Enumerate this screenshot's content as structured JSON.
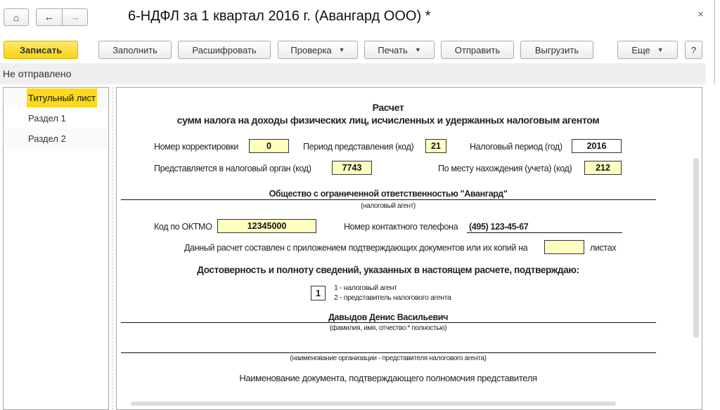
{
  "window": {
    "title": "6-НДФЛ за 1 квартал 2016 г. (Авангард ООО) *",
    "close": "×"
  },
  "toolbar": {
    "save": "Записать",
    "fill": "Заполнить",
    "decode": "Расшифровать",
    "check": "Проверка",
    "print": "Печать",
    "send": "Отправить",
    "export": "Выгрузить",
    "more": "Еще",
    "help": "?"
  },
  "status": "Не отправлено",
  "sidebar": {
    "items": [
      {
        "label": "Титульный лист",
        "active": true
      },
      {
        "label": "Раздел 1"
      },
      {
        "label": "Раздел 2"
      }
    ]
  },
  "form": {
    "title1": "Расчет",
    "title2": "сумм налога на доходы физических лиц, исчисленных и удержанных налоговым агентом",
    "correction_label": "Номер корректировки",
    "correction": "0",
    "period_label": "Период представления (код)",
    "period": "21",
    "year_label": "Налоговый период (год)",
    "year": "2016",
    "tax_org_label": "Представляется в налоговый орган (код)",
    "tax_org": "7743",
    "location_label": "По месту нахождения (учета) (код)",
    "location": "212",
    "org_name": "Общество с ограниченной ответственностью \"Авангард\"",
    "org_caption": "(налоговый агент)",
    "oktmo_label": "Код по ОКТМО",
    "oktmo": "12345000",
    "phone_label": "Номер контактного телефона",
    "phone": "(495) 123-45-67",
    "attach_label": "Данный расчет составлен с приложением подтверждающих документов или их копий на",
    "attach": "",
    "attach_suffix": "листах",
    "confirm": "Достоверность и полноту сведений, указанных в настоящем расчете, подтверждаю:",
    "signer_code": "1",
    "signer_opt1": "1 - налоговый агент",
    "signer_opt2": "2 - представитель налогового агента",
    "fio": "Давыдов Денис Васильевич",
    "fio_caption": "(фамилия, имя, отчество * полностью)",
    "rep_org": "",
    "rep_caption": "(наименование организации - представителя налогового агента)",
    "doc_label": "Наименование документа, подтверждающего полномочия представителя"
  },
  "colors": {
    "accent": "#fbd91d",
    "field": "#ffffc0"
  }
}
